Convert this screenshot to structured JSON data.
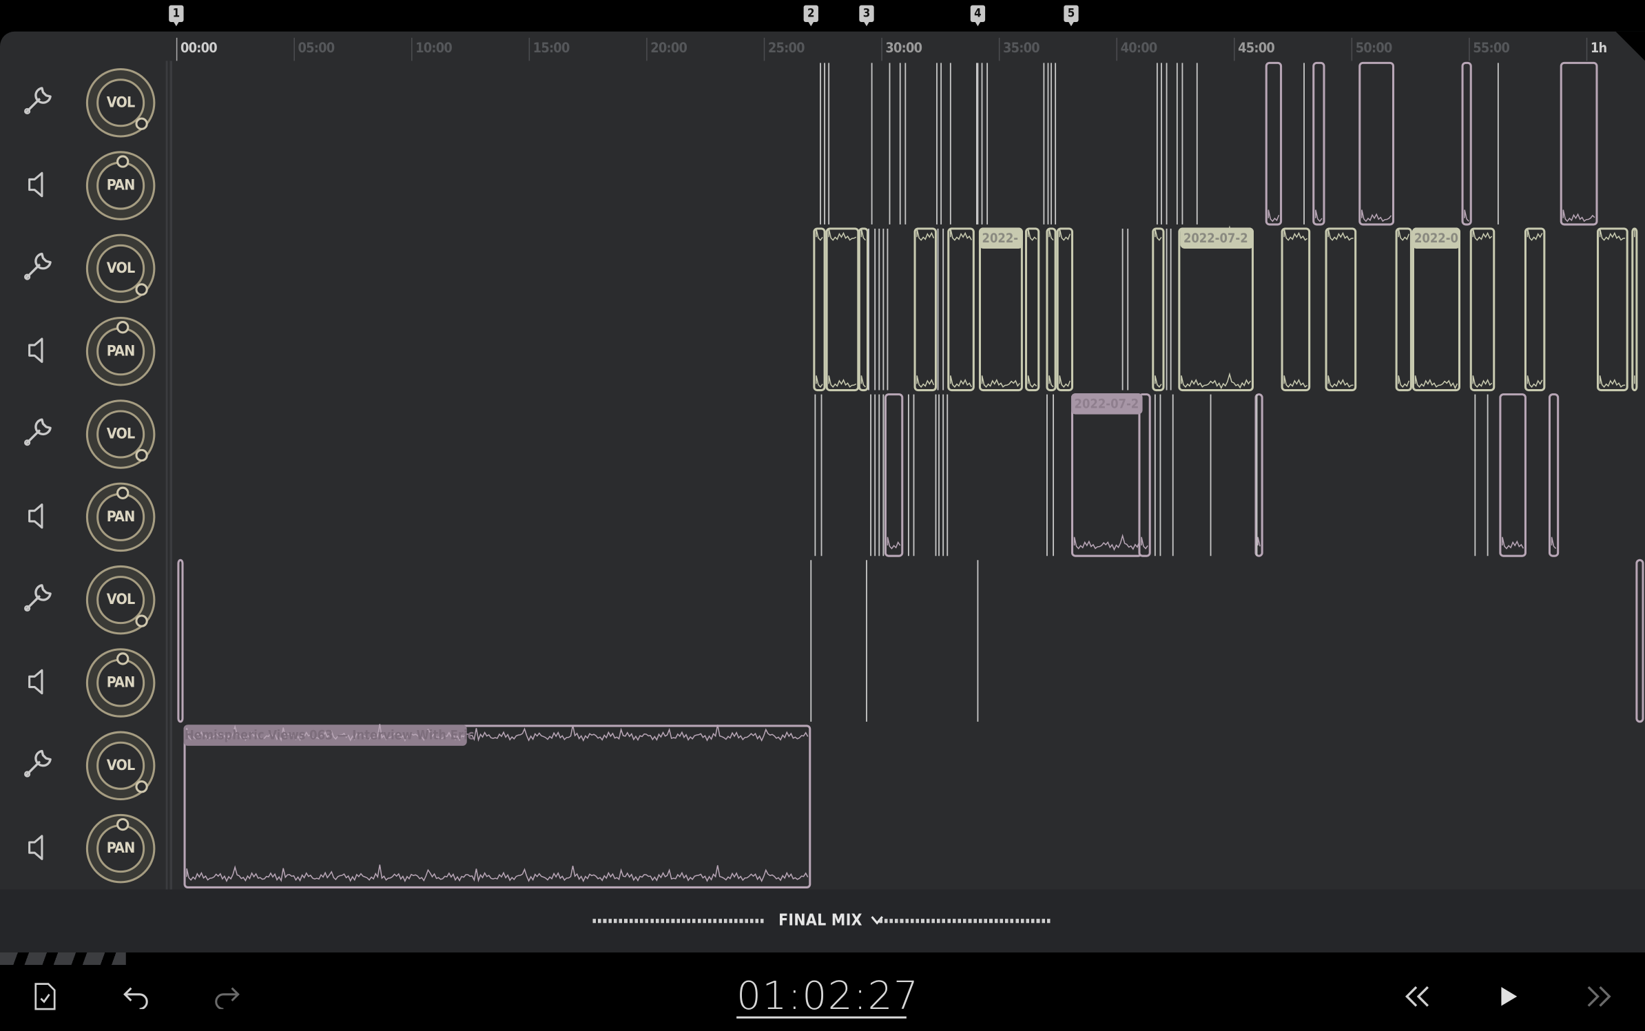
{
  "markers": [
    "1",
    "2",
    "3",
    "4",
    "5"
  ],
  "ruler": {
    "labels": [
      "00:00",
      "05:00",
      "10:00",
      "15:00",
      "20:00",
      "25:00",
      "30:00",
      "35:00",
      "40:00",
      "45:00",
      "50:00",
      "55:00",
      "1h"
    ]
  },
  "tracks": [
    {
      "vol_label": "VOL",
      "pan_label": "PAN"
    },
    {
      "vol_label": "VOL",
      "pan_label": "PAN"
    },
    {
      "vol_label": "VOL",
      "pan_label": "PAN"
    },
    {
      "vol_label": "VOL",
      "pan_label": "PAN"
    },
    {
      "vol_label": "VOL",
      "pan_label": "PAN"
    }
  ],
  "clips": {
    "track3_label_a": "2022-",
    "track3_label_b": "2022-07-2",
    "track3_label_c": "2022-0",
    "track5_label": "Hemispheric Views 063 — Interview With Eric",
    "track4_label": "2022-07-2"
  },
  "mix": {
    "label": "FINAL MIX"
  },
  "transport": {
    "timecode": "01:02:27"
  },
  "colors": {
    "lane_bg": "#2b2c2e",
    "clip_pink": "#b8a6b6",
    "clip_green": "#c8cab0",
    "knob_gold": "#a69d82"
  },
  "icons": {
    "track_settings": "wrench-icon",
    "track_audio": "speaker-icon",
    "export": "document-check-icon",
    "undo": "undo-icon",
    "redo": "redo-icon",
    "rewind": "rewind-icon",
    "play": "play-icon",
    "forward": "fast-forward-icon"
  }
}
